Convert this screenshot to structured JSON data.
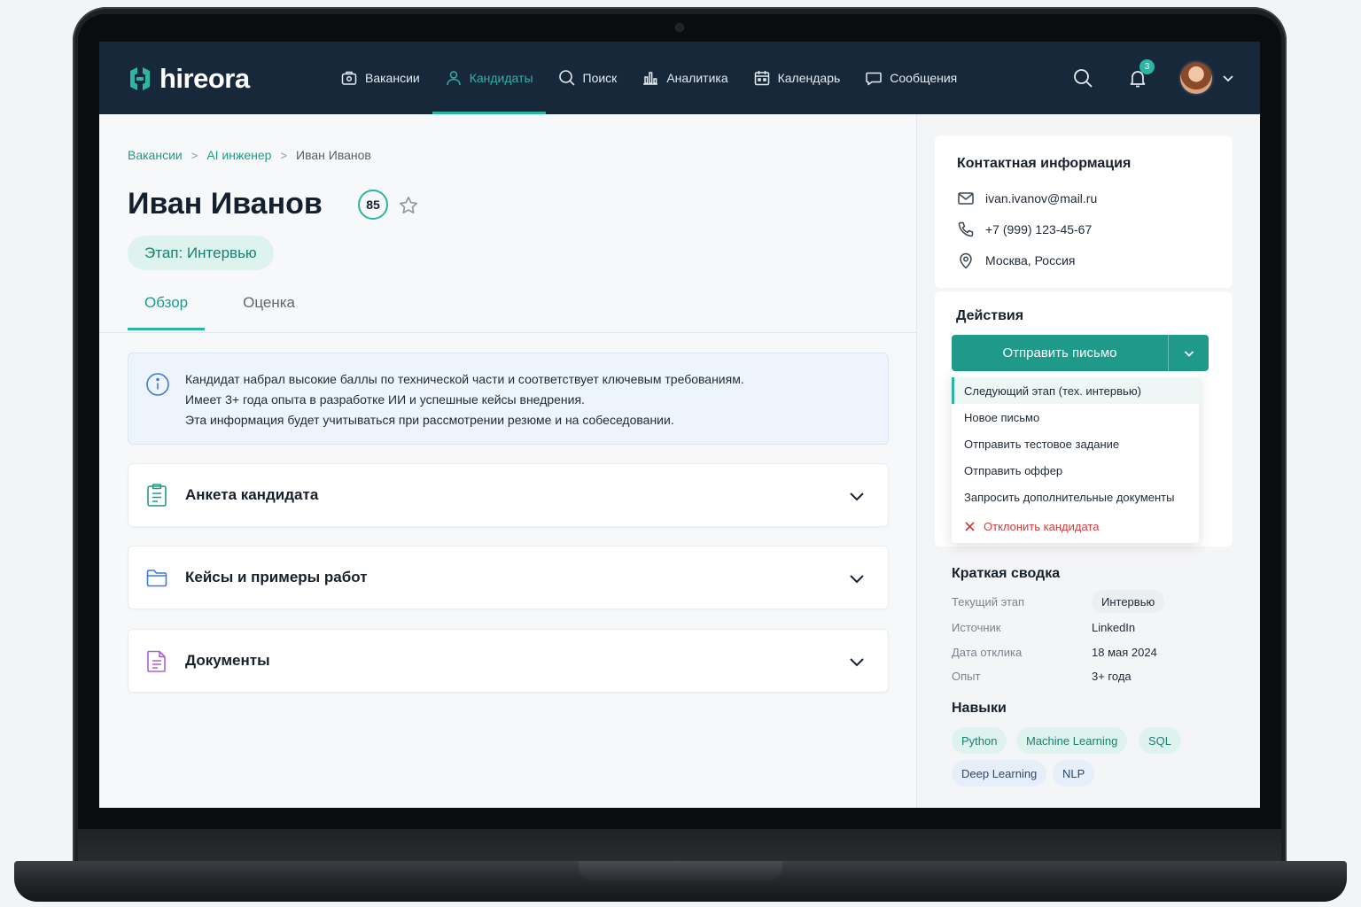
{
  "brand": {
    "name": "hireora",
    "accent": "#2bb5a2",
    "header_bg": "#17283b"
  },
  "nav": [
    {
      "label": "Вакансии",
      "icon": "briefcase-icon"
    },
    {
      "label": "Кандидаты",
      "icon": "user-icon",
      "active": true
    },
    {
      "label": "Поиск",
      "icon": "search-icon"
    },
    {
      "label": "Аналитика",
      "icon": "chart-icon"
    },
    {
      "label": "Календарь",
      "icon": "calendar-icon"
    },
    {
      "label": "Сообщения",
      "icon": "message-icon"
    }
  ],
  "header": {
    "notification_count": "3"
  },
  "breadcrumb": {
    "items": [
      "Вакансии",
      "AI инженер",
      "Иван Иванов"
    ],
    "separator": ">"
  },
  "candidate": {
    "name": "Иван Иванов",
    "score": "85",
    "stage_label": "Этап: Интервью"
  },
  "tabs": [
    {
      "label": "Обзор",
      "active": true
    },
    {
      "label": "Оценка"
    }
  ],
  "info": {
    "lines": [
      "Кандидат набрал высокие баллы по технической части и соответствует ключевым требованиям.",
      "Имеет 3+ года опыта в разработке ИИ и успешные кейсы внедрения.",
      "Эта информация будет учитываться при рассмотрении резюме и на собеседовании."
    ]
  },
  "sections": [
    {
      "title": "Анкета кандидата",
      "icon": "clipboard-icon"
    },
    {
      "title": "Кейсы и примеры работ",
      "icon": "folder-icon"
    },
    {
      "title": "Документы",
      "icon": "document-icon"
    }
  ],
  "contact": {
    "title": "Контактная информация",
    "email": "ivan.ivanov@mail.ru",
    "phone": "+7 (999) 123-45-67",
    "location": "Москва, Россия"
  },
  "actions": {
    "title": "Действия",
    "primary": "Отправить письмо",
    "menu": [
      "Следующий этап (тех. интервью)",
      "Новое письмо",
      "Отправить тестовое задание",
      "Отправить оффер",
      "Запросить дополнительные документы"
    ],
    "reject": "Отклонить кандидата"
  },
  "summary": {
    "title": "Краткая сводка",
    "rows": [
      {
        "label": "Текущий этап",
        "value": "Интервью"
      },
      {
        "label": "Источник",
        "value": "LinkedIn"
      },
      {
        "label": "Дата отклика",
        "value": "18 мая 2024"
      },
      {
        "label": "Опыт",
        "value": "3+ года"
      }
    ]
  },
  "skills": {
    "title": "Навыки",
    "items": [
      "Python",
      "Machine Learning",
      "SQL",
      "Deep Learning",
      "NLP"
    ]
  }
}
